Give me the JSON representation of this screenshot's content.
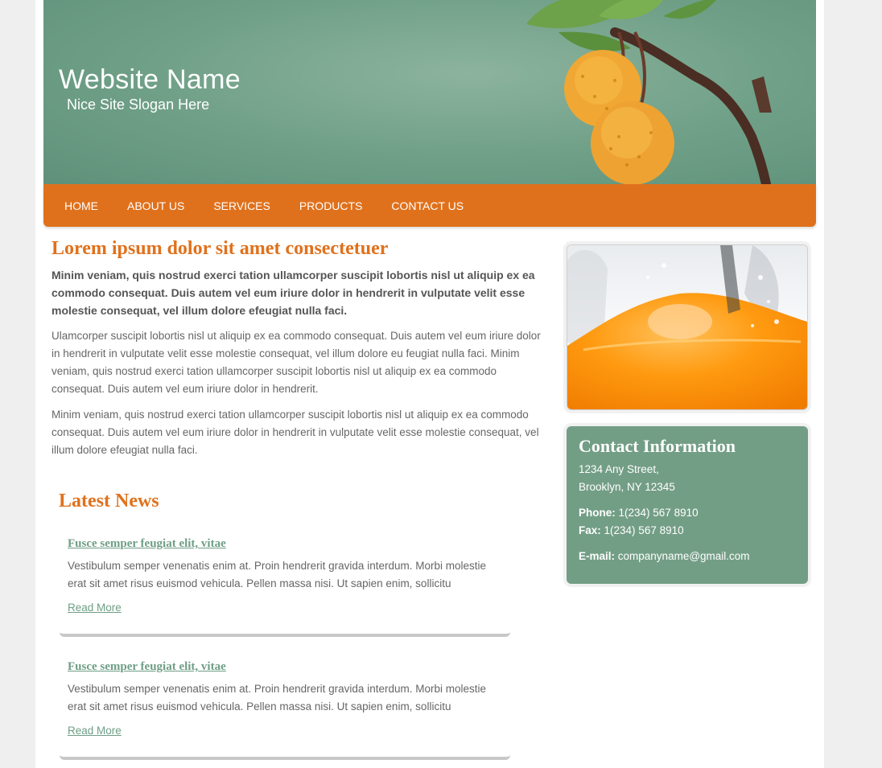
{
  "header": {
    "site_name": "Website Name",
    "slogan": "Nice Site Slogan Here"
  },
  "nav": {
    "items": [
      "HOME",
      "ABOUT US",
      "SERVICES",
      "PRODUCTS",
      "CONTACT US"
    ]
  },
  "main": {
    "heading": "Lorem ipsum dolor sit amet consectetuer",
    "lead": "Minim veniam, quis nostrud exerci tation ullamcorper suscipit lobortis nisl ut aliquip ex ea commodo consequat. Duis autem vel eum iriure dolor in hendrerit in vulputate velit esse molestie consequat, vel illum dolore efeugiat nulla faci.",
    "paragraphs": [
      "Ulamcorper suscipit lobortis nisl ut aliquip ex ea commodo consequat. Duis autem vel eum iriure dolor in hendrerit in vulputate velit esse molestie consequat, vel illum dolore eu feugiat nulla faci. Minim veniam, quis nostrud exerci tation ullamcorper suscipit lobortis nisl ut aliquip ex ea commodo consequat. Duis autem vel eum iriure dolor in hendrerit.",
      "Minim veniam, quis nostrud exerci tation ullamcorper suscipit lobortis nisl ut aliquip ex ea commodo consequat. Duis autem vel eum iriure dolor in hendrerit in vulputate velit esse molestie consequat, vel illum dolore efeugiat nulla faci."
    ]
  },
  "news": {
    "title": "Latest News",
    "items": [
      {
        "title": "Fusce semper feugiat elit, vitae",
        "text": "Vestibulum semper venenatis enim at. Proin hendrerit gravida interdum. Morbi molestie erat sit amet risus euismod vehicula. Pellen massa nisi. Ut sapien enim, sollicitu",
        "more": "Read More"
      },
      {
        "title": "Fusce semper feugiat elit, vitae",
        "text": "Vestibulum semper venenatis enim at. Proin hendrerit gravida interdum. Morbi molestie erat sit amet risus euismod vehicula. Pellen massa nisi. Ut sapien enim, sollicitu",
        "more": "Read More"
      }
    ]
  },
  "contact": {
    "title": "Contact Information",
    "address1": "1234 Any Street,",
    "address2": "Brooklyn, NY 12345",
    "phone_label": "Phone:",
    "phone": "1(234) 567 8910",
    "fax_label": "Fax:",
    "fax": "1(234) 567 8910",
    "email_label": "E-mail:",
    "email": "companyname@gmail.com"
  },
  "colors": {
    "accent": "#e0711c",
    "green": "#739e86",
    "link": "#6e9e85"
  }
}
